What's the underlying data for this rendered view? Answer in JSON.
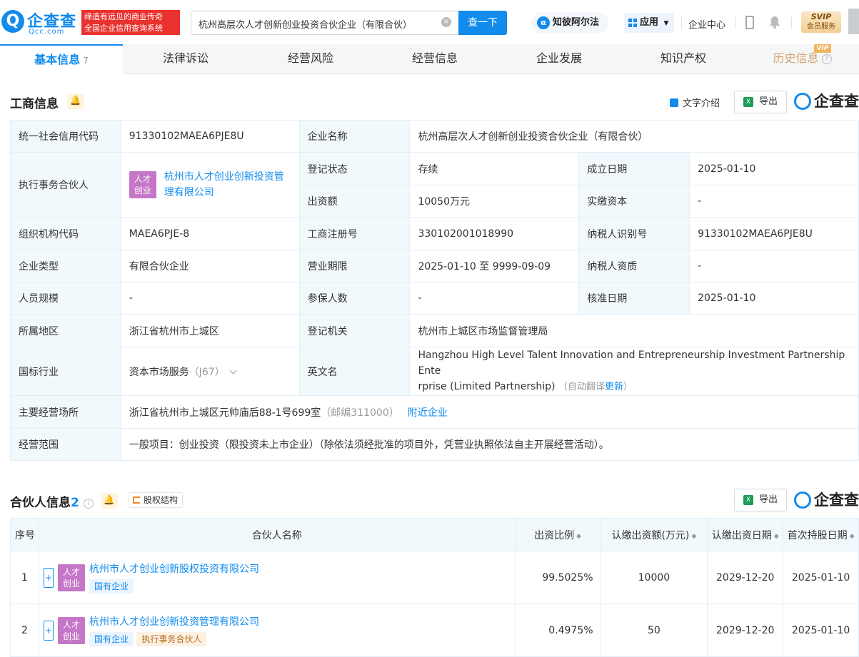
{
  "header": {
    "logo_mark": "Q",
    "logo_cn": "企查查",
    "logo_en": "Qcc.com",
    "slogan_line1": "缔造有远见的商业传奇",
    "slogan_line2": "全国企业信用查询系统",
    "search_value": "杭州高层次人才创新创业投资合伙企业（有限合伙）",
    "search_button": "查一下",
    "ai_button": "知彼阿尔法",
    "apps_button": "应用",
    "enterprise_center": "企业中心",
    "svip_line1": "SVIP",
    "svip_line2": "会员服务"
  },
  "tabs": [
    {
      "label": "基本信息",
      "count": "7"
    },
    {
      "label": "法律诉讼"
    },
    {
      "label": "经营风险"
    },
    {
      "label": "经营信息"
    },
    {
      "label": "企业发展"
    },
    {
      "label": "知识产权"
    },
    {
      "label": "历史信息",
      "badge": "VIP"
    }
  ],
  "business_info": {
    "title": "工商信息",
    "text_intro": "文字介绍",
    "export": "导出",
    "brand": "企查查",
    "rows": {
      "credit_code_label": "统一社会信用代码",
      "credit_code": "91330102MAEA6PJE8U",
      "company_name_label": "企业名称",
      "company_name": "杭州高层次人才创新创业投资合伙企业（有限合伙）",
      "exec_partner_label": "执行事务合伙人",
      "exec_partner_logo_1": "人才",
      "exec_partner_logo_2": "创业",
      "exec_partner_name_1": "杭州市人才创业创新投资管",
      "exec_partner_name_2": "理有限公司",
      "reg_status_label": "登记状态",
      "reg_status": "存续",
      "established_label": "成立日期",
      "established": "2025-01-10",
      "capital_label": "出资额",
      "capital": "10050万元",
      "paid_capital_label": "实缴资本",
      "paid_capital": "-",
      "org_code_label": "组织机构代码",
      "org_code": "MAEA6PJE-8",
      "reg_no_label": "工商注册号",
      "reg_no": "330102001018990",
      "taxpayer_id_label": "纳税人识别号",
      "taxpayer_id": "91330102MAEA6PJE8U",
      "company_type_label": "企业类型",
      "company_type": "有限合伙企业",
      "term_label": "营业期限",
      "term": "2025-01-10 至 9999-09-09",
      "taxpayer_qual_label": "纳税人资质",
      "taxpayer_qual": "-",
      "staff_label": "人员规模",
      "staff": "-",
      "insured_label": "参保人数",
      "insured": "-",
      "approved_label": "核准日期",
      "approved": "2025-01-10",
      "region_label": "所属地区",
      "region": "浙江省杭州市上城区",
      "authority_label": "登记机关",
      "authority": "杭州市上城区市场监督管理局",
      "industry_label": "国标行业",
      "industry": "资本市场服务",
      "industry_code": "（J67）",
      "en_name_label": "英文名",
      "en_name_1": "Hangzhou High Level Talent Innovation and Entrepreneurship Investment Partnership Ente",
      "en_name_2": "rprise (Limited Partnership)",
      "en_name_note": "（自动翻译",
      "en_name_update": "更新",
      "en_name_close": "）",
      "address_label": "主要经营场所",
      "address": "浙江省杭州市上城区元帅庙后88-1号699室",
      "postcode": "（邮编311000）",
      "nearby": "附近企业",
      "scope_label": "经营范围",
      "scope": "一般项目：创业投资（限投资未上市企业）（除依法须经批准的项目外，凭营业执照依法自主开展经营活动）。"
    }
  },
  "partners": {
    "title": "合伙人信息",
    "count": "2",
    "equity_structure": "股权结构",
    "export": "导出",
    "brand": "企查查",
    "columns": [
      "序号",
      "合伙人名称",
      "出资比例",
      "认缴出资额(万元)",
      "认缴出资日期",
      "首次持股日期"
    ],
    "rows": [
      {
        "no": "1",
        "logo_1": "人才",
        "logo_2": "创业",
        "name": "杭州市人才创业创新股权投资有限公司",
        "tags": [
          "国有企业"
        ],
        "ratio": "99.5025%",
        "amount": "10000",
        "sub_date": "2029-12-20",
        "first_date": "2025-01-10"
      },
      {
        "no": "2",
        "logo_1": "人才",
        "logo_2": "创业",
        "name": "杭州市人才创业创新投资管理有限公司",
        "tags": [
          "国有企业",
          "执行事务合伙人"
        ],
        "ratio": "0.4975%",
        "amount": "50",
        "sub_date": "2029-12-20",
        "first_date": "2025-01-10"
      }
    ]
  },
  "colors": {
    "primary": "#128bed",
    "label_bg": "#f2f9fc",
    "brand_red": "#e9312e",
    "logo_purple": "#c576c7",
    "vip_gold": "#f2b55a"
  }
}
